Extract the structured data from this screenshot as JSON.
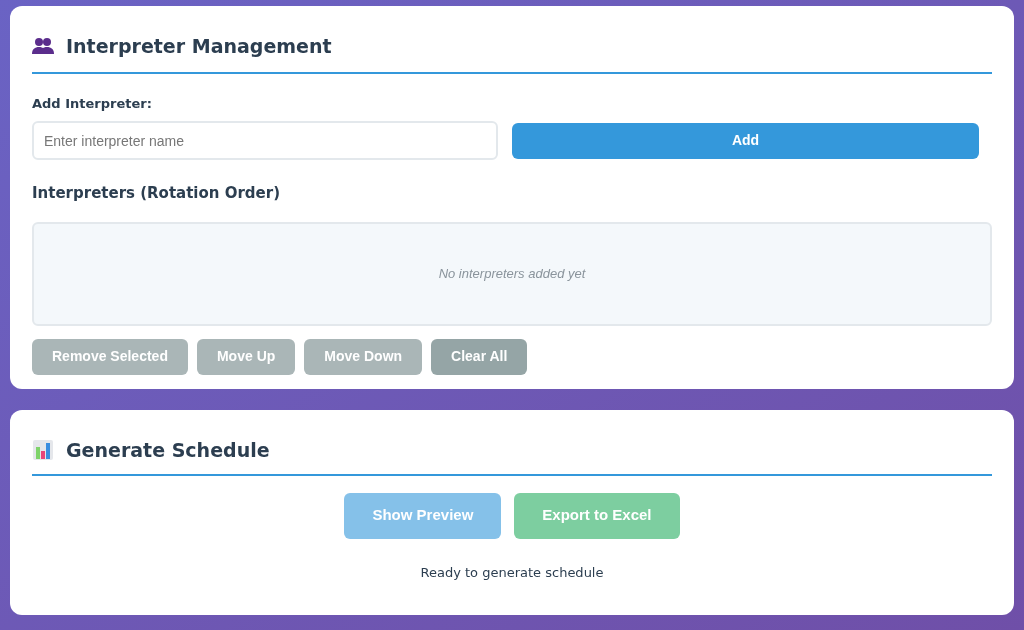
{
  "management": {
    "title": "Interpreter Management",
    "add_label": "Add Interpreter:",
    "name_field": {
      "placeholder": "Enter interpreter name"
    },
    "add_button": {
      "label": "Add",
      "disabled": false
    },
    "list_title": "Interpreters (Rotation Order)",
    "empty_message": "No interpreters added yet",
    "actions": [
      {
        "label": "Remove Selected",
        "disabled": true
      },
      {
        "label": "Move Up",
        "disabled": true
      },
      {
        "label": "Move Down",
        "disabled": true
      },
      {
        "label": "Clear All",
        "disabled": false
      }
    ]
  },
  "schedule": {
    "title": "Generate Schedule",
    "buttons": [
      {
        "label": "Show Preview",
        "kind": "preview",
        "disabled": true
      },
      {
        "label": "Export to Excel",
        "kind": "export",
        "disabled": true
      }
    ],
    "status": "Ready to generate schedule"
  }
}
